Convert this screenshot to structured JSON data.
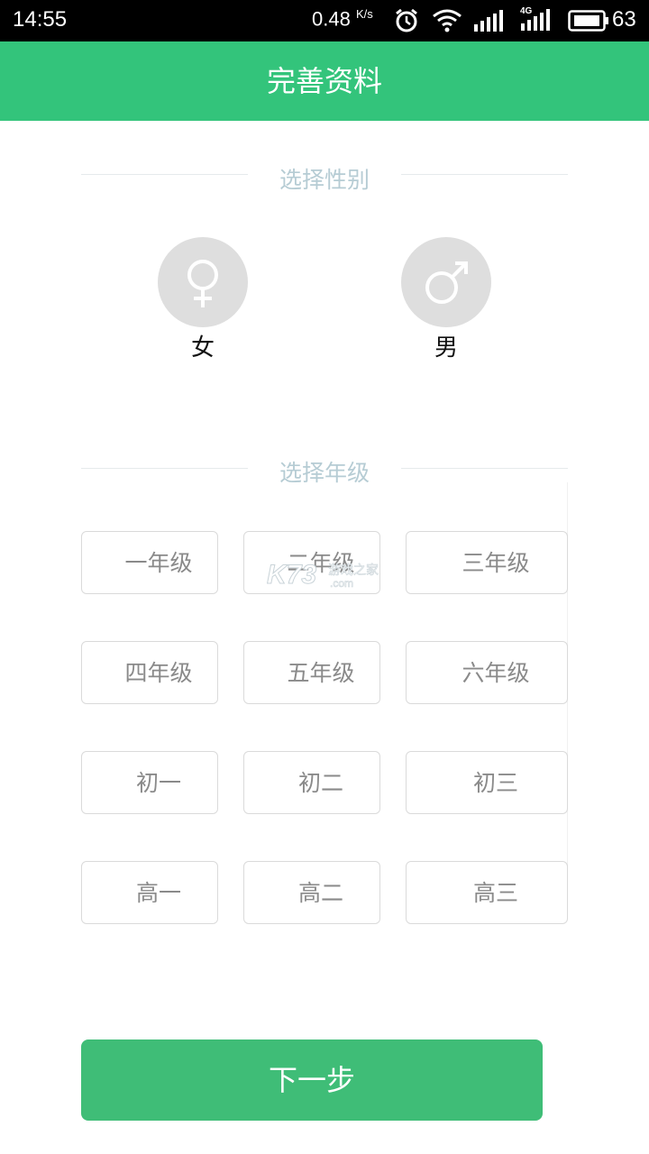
{
  "status_bar": {
    "time": "14:55",
    "speed": "0.48",
    "speed_unit": "K/s",
    "network": "4G",
    "battery": "63",
    "icons": [
      "alarm-icon",
      "wifi-icon",
      "signal-icon",
      "signal-4g-icon",
      "battery-icon"
    ]
  },
  "header": {
    "title": "完善资料"
  },
  "gender_section": {
    "title": "选择性别",
    "options": [
      {
        "label": "女",
        "icon": "female-icon"
      },
      {
        "label": "男",
        "icon": "male-icon"
      }
    ]
  },
  "grade_section": {
    "title": "选择年级",
    "grades": [
      [
        "一年级",
        "二年级",
        "三年级"
      ],
      [
        "四年级",
        "五年级",
        "六年级"
      ],
      [
        "初一",
        "初二",
        "初三"
      ],
      [
        "高一",
        "高二",
        "高三"
      ]
    ]
  },
  "footer": {
    "next_label": "下一步"
  },
  "watermark": {
    "brand": "K73",
    "text": "游戏之家",
    "domain": ".com"
  },
  "colors": {
    "accent": "#33c47b",
    "button": "#3fbd77",
    "section_title": "#b6ccd4",
    "icon_circle": "#dedede"
  }
}
